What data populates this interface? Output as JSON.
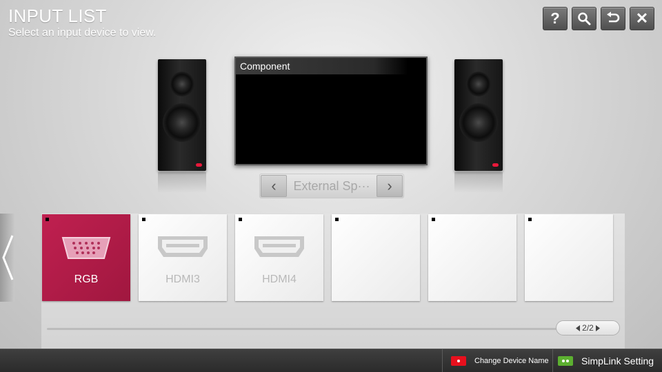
{
  "header": {
    "title": "INPUT LIST",
    "subtitle": "Select an input device to view."
  },
  "top_buttons": [
    {
      "icon": "help-icon",
      "glyph": "?"
    },
    {
      "icon": "search-icon",
      "glyph": ""
    },
    {
      "icon": "back-icon",
      "glyph": "↺"
    },
    {
      "icon": "close-icon",
      "glyph": "✕"
    }
  ],
  "preview": {
    "current_input": "Component"
  },
  "speakers_selector": {
    "value": "External Sp···",
    "prev_glyph": "‹",
    "next_glyph": "›"
  },
  "input_tiles": [
    {
      "label": "RGB",
      "icon": "rgb-port-icon",
      "selected": true
    },
    {
      "label": "HDMI3",
      "icon": "hdmi-port-icon",
      "selected": false
    },
    {
      "label": "HDMI4",
      "icon": "hdmi-port-icon",
      "selected": false
    },
    {
      "label": "",
      "icon": "",
      "selected": false
    },
    {
      "label": "",
      "icon": "",
      "selected": false
    },
    {
      "label": "",
      "icon": "",
      "selected": false
    }
  ],
  "pager": {
    "text": "2/2"
  },
  "bottom_bar": {
    "red_label": "Change Device Name",
    "green_label": "SimpLink Setting"
  },
  "colors": {
    "selected_tile": "#b01c48",
    "red_key": "#e8101d",
    "green_key": "#5cb030"
  }
}
